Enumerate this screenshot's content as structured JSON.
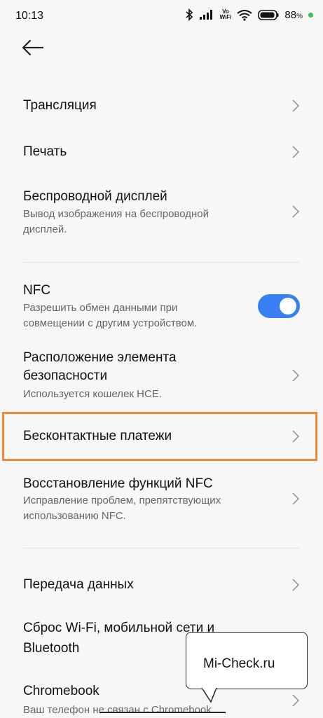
{
  "status_bar": {
    "time": "10:13",
    "vowifi_top": "Vo",
    "vowifi_bottom": "WiFi",
    "battery_value": "88",
    "battery_unit": "%",
    "icons": [
      "bluetooth-icon",
      "signal-icon",
      "vowifi-icon",
      "wifi-icon",
      "battery-icon",
      "charging-dot-icon"
    ]
  },
  "nav": {
    "back_icon": "arrow-left-icon"
  },
  "items": [
    {
      "title": "Трансляция"
    },
    {
      "title": "Печать"
    },
    {
      "title": "Беспроводной дисплей",
      "subtitle_1": "Вывод изображения на беспроводной",
      "subtitle_2": "дисплей."
    },
    {
      "title": "NFC",
      "subtitle_1": "Разрешить обмен данными при",
      "subtitle_2": "совмещении с другим устройством.",
      "toggle_on": true
    },
    {
      "title_1": "Расположение элемента",
      "title_2": "безопасности",
      "subtitle_1": "Используется кошелек HCE."
    },
    {
      "title": "Бесконтактные платежи"
    },
    {
      "title": "Восстановление функций NFC",
      "subtitle_1": "Исправление проблем, препятствующих",
      "subtitle_2": "использованию NFC."
    },
    {
      "title": "Передача данных"
    },
    {
      "title_1": "Сброс Wi-Fi, мобильной сети и",
      "title_2": "Bluetooth"
    },
    {
      "title": "Chromebook",
      "subtitle_1": "Ваш телефон не связан с Chromebook"
    }
  ],
  "watermark": {
    "text": "Mi-Check.ru"
  },
  "colors": {
    "toggle": "#3a7ff2",
    "highlight": "#f0883a",
    "battery_dot": "#3bbf57"
  }
}
